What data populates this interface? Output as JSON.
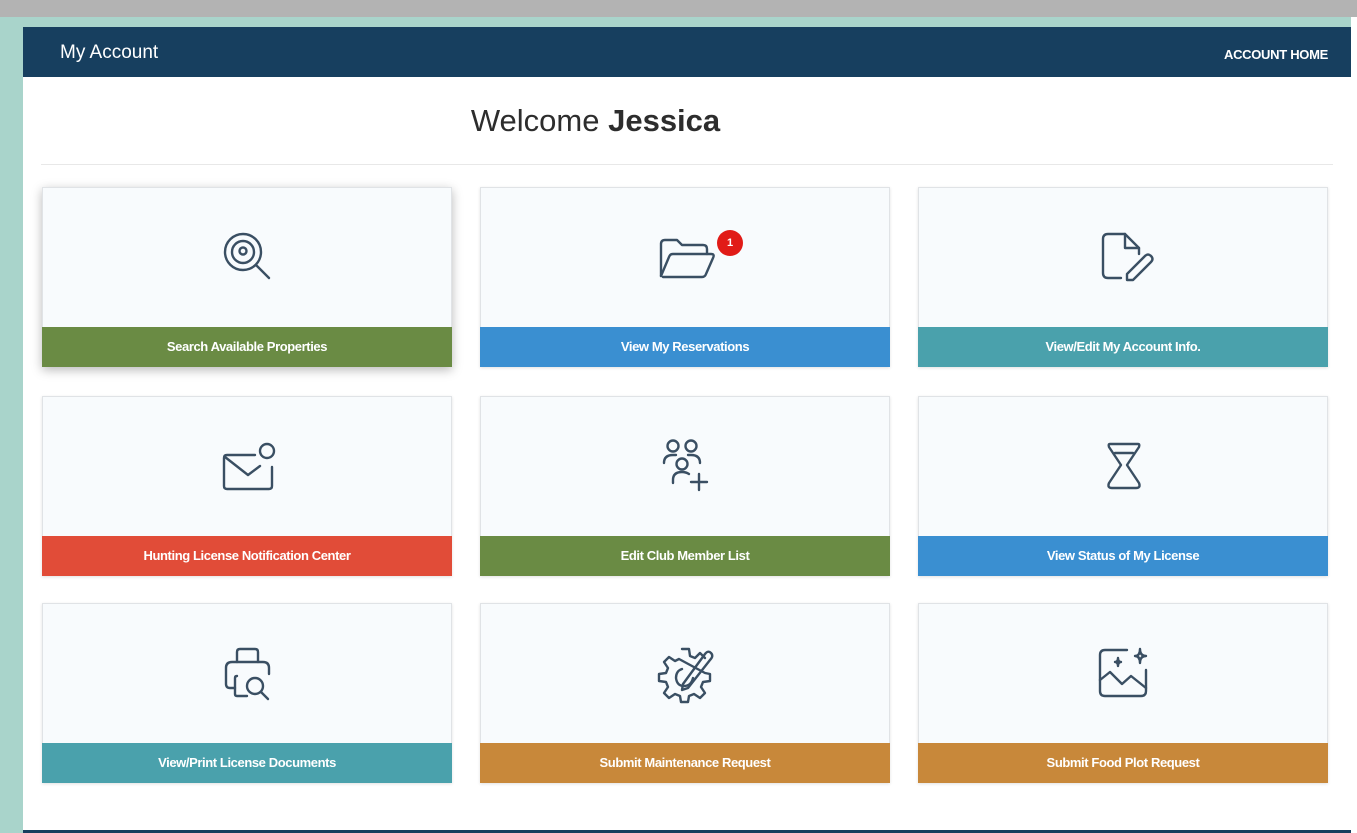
{
  "header": {
    "title": "My Account",
    "account_home_link": "ACCOUNT HOME"
  },
  "welcome": {
    "greeting": "Welcome",
    "name": "Jessica"
  },
  "colors": {
    "header_bg": "#173f5f",
    "green": "#6a8b44",
    "blue": "#3a8fd1",
    "teal": "#4aa1ac",
    "red": "#e14c38",
    "orange": "#c8883a",
    "badge": "#e11b17"
  },
  "tiles": [
    {
      "label": "Search Available Properties",
      "icon": "search-location-icon",
      "color": "green"
    },
    {
      "label": "View My Reservations",
      "icon": "folder-open-icon",
      "color": "blue",
      "badge": "1"
    },
    {
      "label": "View/Edit My Account Info.",
      "icon": "document-edit-icon",
      "color": "teal"
    },
    {
      "label": "Hunting License Notification Center",
      "icon": "mail-notification-icon",
      "color": "red"
    },
    {
      "label": "Edit Club Member List",
      "icon": "people-add-icon",
      "color": "green"
    },
    {
      "label": "View Status of My License",
      "icon": "hourglass-icon",
      "color": "blue"
    },
    {
      "label": "View/Print License Documents",
      "icon": "print-search-icon",
      "color": "teal"
    },
    {
      "label": "Submit Maintenance Request",
      "icon": "gear-wrench-icon",
      "color": "orange"
    },
    {
      "label": "Submit Food Plot Request",
      "icon": "image-sparkle-icon",
      "color": "orange"
    }
  ]
}
